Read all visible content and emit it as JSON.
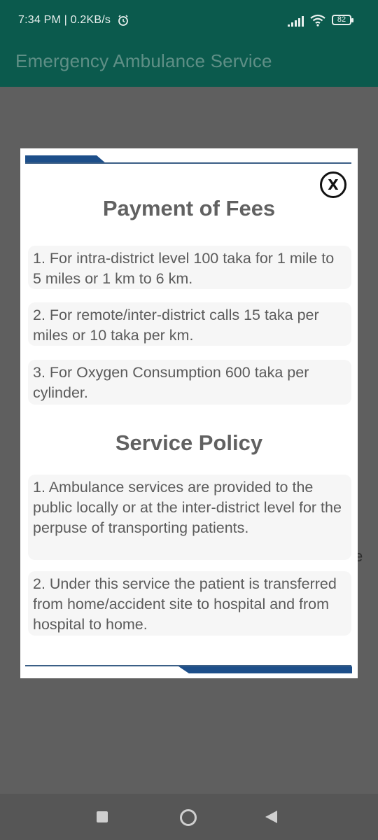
{
  "status_bar": {
    "time_speed": "7:34 PM | 0.2KB/s",
    "battery": "82",
    "icons": [
      "alarm-icon",
      "signal-icon",
      "wifi-icon",
      "battery-icon"
    ]
  },
  "app_bar": {
    "title": "Emergency Ambulance Service"
  },
  "background": {
    "fragment": "e"
  },
  "dialog": {
    "close_label": "X",
    "fees_heading": "Payment of Fees",
    "fees": [
      "1. For intra-district level 100 taka for 1 mile to 5 miles or 1 km to 6 km.",
      "2. For remote/inter-district calls 15 taka per miles or 10 taka per km.",
      "3. For Oxygen Consumption 600 taka per cylinder."
    ],
    "policy_heading": "Service Policy",
    "policies": [
      "1. Ambulance services are provided to the public locally or at the inter-district level for the perpuse of transporting patients.",
      "2. Under this service the patient is transferred from home/accident site to hospital and from hospital to home."
    ]
  },
  "nav_bar": {
    "icons": [
      "recents-icon",
      "home-icon",
      "back-icon"
    ]
  },
  "colors": {
    "app_bar": "#0b5a4d",
    "title_text": "#5f8f86",
    "scrim": "#5f5f5f",
    "accent_blue": "#1d4f8a"
  }
}
